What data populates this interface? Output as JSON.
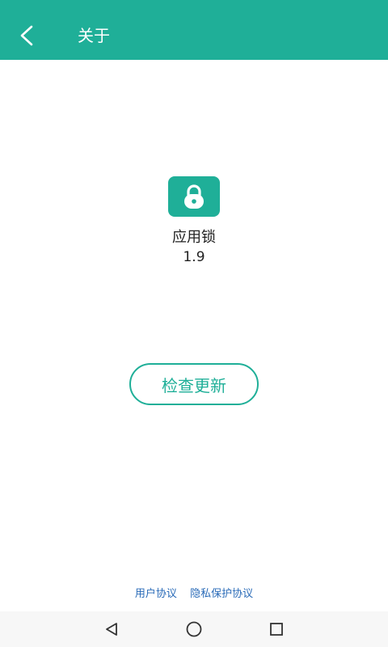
{
  "header": {
    "title": "关于",
    "back_icon": "chevron-left-icon"
  },
  "app_info": {
    "icon": "lock-icon",
    "name": "应用锁",
    "version": "1.9"
  },
  "actions": {
    "check_update_label": "检查更新"
  },
  "footer": {
    "links": [
      {
        "label": "用户协议"
      },
      {
        "label": "隐私保护协议"
      }
    ]
  },
  "system_nav": {
    "back_icon": "triangle-back-icon",
    "home_icon": "circle-home-icon",
    "recents_icon": "square-recents-icon"
  },
  "colors": {
    "accent": "#1faf98",
    "link": "#2a6bb8",
    "nav_bg": "#f7f7f7"
  }
}
